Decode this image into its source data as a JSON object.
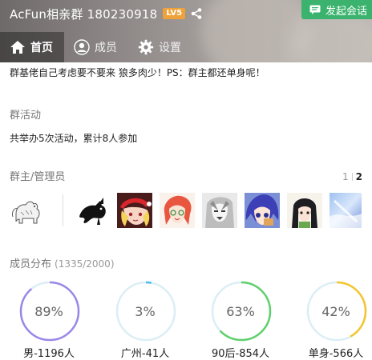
{
  "header": {
    "title": "AcFun相亲群 180230918",
    "level_badge": "LV5",
    "share_icon": "share-icon",
    "start_chat": {
      "label": "发起会话",
      "icon": "chat-icon",
      "color": "#3bb36e"
    }
  },
  "tabs": [
    {
      "label": "首页",
      "icon": "home-icon",
      "active": true
    },
    {
      "label": "成员",
      "icon": "user-icon",
      "active": false
    },
    {
      "label": "设置",
      "icon": "gear-icon",
      "active": false
    }
  ],
  "notice": "群基佬自己考虑要不要来 狼多肉少！PS：群主都还单身呢！",
  "activity": {
    "title": "群活动",
    "text": "共举办5次活动，累计8人参加"
  },
  "admins": {
    "title": "群主/管理员",
    "pager": {
      "pages": [
        "1",
        "2"
      ],
      "current": "2"
    },
    "avatars": [
      {
        "name": "owner-avatar"
      },
      {
        "name": "admin-avatar-1"
      },
      {
        "name": "admin-avatar-2"
      },
      {
        "name": "admin-avatar-3"
      },
      {
        "name": "admin-avatar-4"
      },
      {
        "name": "admin-avatar-5"
      },
      {
        "name": "admin-avatar-6"
      },
      {
        "name": "admin-avatar-7"
      }
    ]
  },
  "distribution": {
    "title": "成员分布",
    "count": "(1335/2000)",
    "items": [
      {
        "percent_label": "89%",
        "value": 0.89,
        "label": "男-1196人",
        "color": "#9b87e8"
      },
      {
        "percent_label": "3%",
        "value": 0.03,
        "label": "广州-41人",
        "color": "#4bb8ef"
      },
      {
        "percent_label": "63%",
        "value": 0.63,
        "label": "90后-854人",
        "color": "#5fd06b"
      },
      {
        "percent_label": "42%",
        "value": 0.42,
        "label": "单身-566人",
        "color": "#f3c52d"
      }
    ],
    "track_color": "#dbeef6"
  }
}
